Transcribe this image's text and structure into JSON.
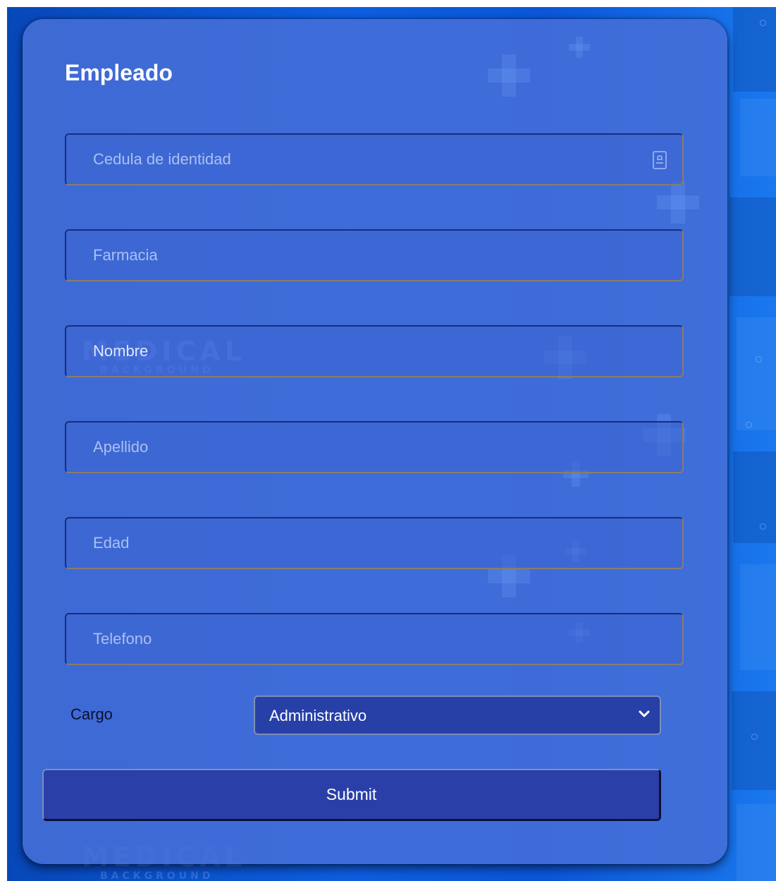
{
  "form": {
    "title": "Empleado",
    "fields": [
      {
        "name": "cedula",
        "placeholder": "Cedula de identidad",
        "value": ""
      },
      {
        "name": "farmacia",
        "placeholder": "Farmacia",
        "value": ""
      },
      {
        "name": "nombre",
        "placeholder": "Nombre",
        "value": ""
      },
      {
        "name": "apellido",
        "placeholder": "Apellido",
        "value": ""
      },
      {
        "name": "edad",
        "placeholder": "Edad",
        "value": ""
      },
      {
        "name": "telefono",
        "placeholder": "Telefono",
        "value": ""
      }
    ],
    "cargo": {
      "label": "Cargo",
      "selected": "Administrativo"
    },
    "submit_label": "Submit"
  },
  "background": {
    "watermark_title": "MEDICAL",
    "watermark_subtitle": "BACKGROUND"
  },
  "icons": {
    "cedula_field_icon": "id-card-icon",
    "select_icon": "chevron-down-icon"
  },
  "colors": {
    "page_background": "#0a4fcf",
    "card_background": "#466ed7",
    "button_background": "#2a3fa8",
    "title_text": "#ffffff"
  }
}
